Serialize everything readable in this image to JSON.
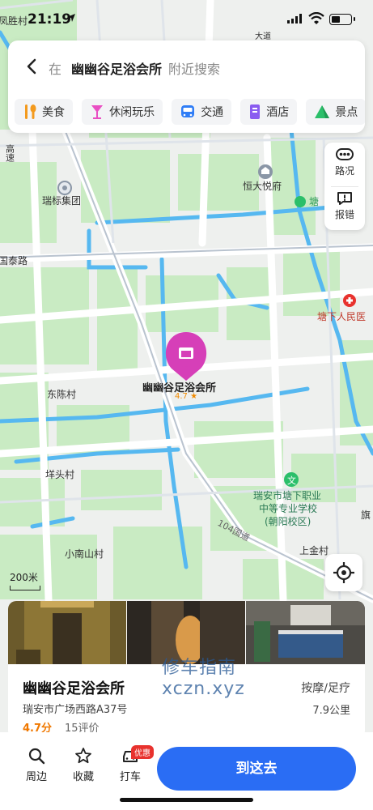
{
  "status_bar": {
    "time": "21:19"
  },
  "search": {
    "prefix": "在",
    "keyword": "幽幽谷足浴会所",
    "suffix": "附近搜索"
  },
  "categories": [
    {
      "label": "美食",
      "icon": "food-icon",
      "color": "#f39a1e"
    },
    {
      "label": "休闲玩乐",
      "icon": "leisure-icon",
      "color": "#e94fc3"
    },
    {
      "label": "交通",
      "icon": "bus-icon",
      "color": "#2f7df6"
    },
    {
      "label": "酒店",
      "icon": "hotel-icon",
      "color": "#8a5cf0"
    },
    {
      "label": "景点",
      "icon": "scenic-icon",
      "color": "#2bbf6a"
    }
  ],
  "side_tools": {
    "traffic": "路况",
    "report": "报错"
  },
  "map_labels": {
    "road_top_left": "凤胜村",
    "road_top": "大道",
    "highway": "高速",
    "ruibiao": "瑞标集团",
    "hengda": "恒大悦府",
    "tangxia_partial": "塘",
    "taiting": "国泰路",
    "hospital": "塘下人民医",
    "dongchen": "东陈村",
    "yangtou": "垟头村",
    "school_line1": "瑞安市塘下职业",
    "school_line2": "中等专业学校",
    "school_line3": "(朝阳校区)",
    "road_104": "104国道",
    "shangjin": "上金村",
    "xiaonanshan": "小南山村",
    "edge_qi": "旗"
  },
  "pin": {
    "name": "幽幽谷足浴会所",
    "rating": "4.7 ★"
  },
  "scale": "200米",
  "place": {
    "name": "幽幽谷足浴会所",
    "category": "按摩/足疗",
    "address": "瑞安市广场西路A37号",
    "distance": "7.9公里",
    "score": "4.7分",
    "reviews": "15评价"
  },
  "watermark": {
    "line1": "修车指南",
    "line2": "xczn.xyz"
  },
  "bottom_nav": {
    "around": "周边",
    "favorite": "收藏",
    "taxi": "打车",
    "promo": "优惠",
    "go": "到这去"
  }
}
